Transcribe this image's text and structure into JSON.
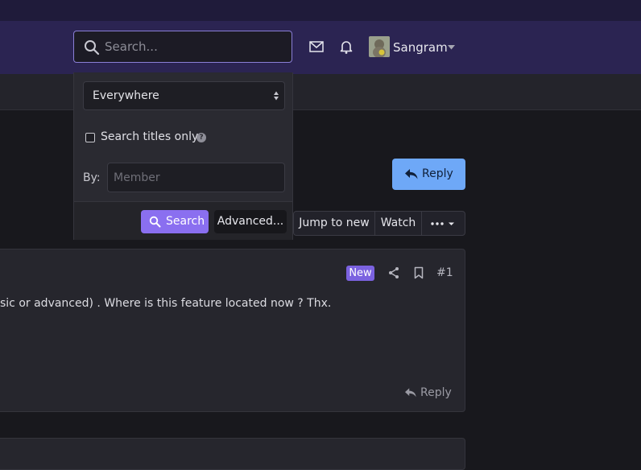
{
  "header": {
    "search": {
      "placeholder": "Search..."
    },
    "user": {
      "name": "Sangram"
    },
    "icons": [
      "search-icon",
      "envelope-icon",
      "bell-icon",
      "chevron-down-icon"
    ]
  },
  "search_menu": {
    "scope_selected": "Everywhere",
    "titles_only_label": "Search titles only",
    "titles_only_checked": false,
    "by_label": "By:",
    "member_placeholder": "Member",
    "search_button": "Search",
    "advanced_button": "Advanced..."
  },
  "thread_actions": {
    "reply_button": "Reply",
    "jump_to_new": "Jump to new",
    "watch": "Watch",
    "more_icon": "ellipsis-icon"
  },
  "post": {
    "badge": "New",
    "number": "#1",
    "text": "sic or advanced) . Where is this feature located now ? Thx.",
    "reply_link": "Reply"
  },
  "colors": {
    "header_bg": "#2b2452",
    "accent_purple": "#8a6ff0",
    "reply_blue": "#6ea8f7",
    "badge_new": "#7b62e0"
  }
}
